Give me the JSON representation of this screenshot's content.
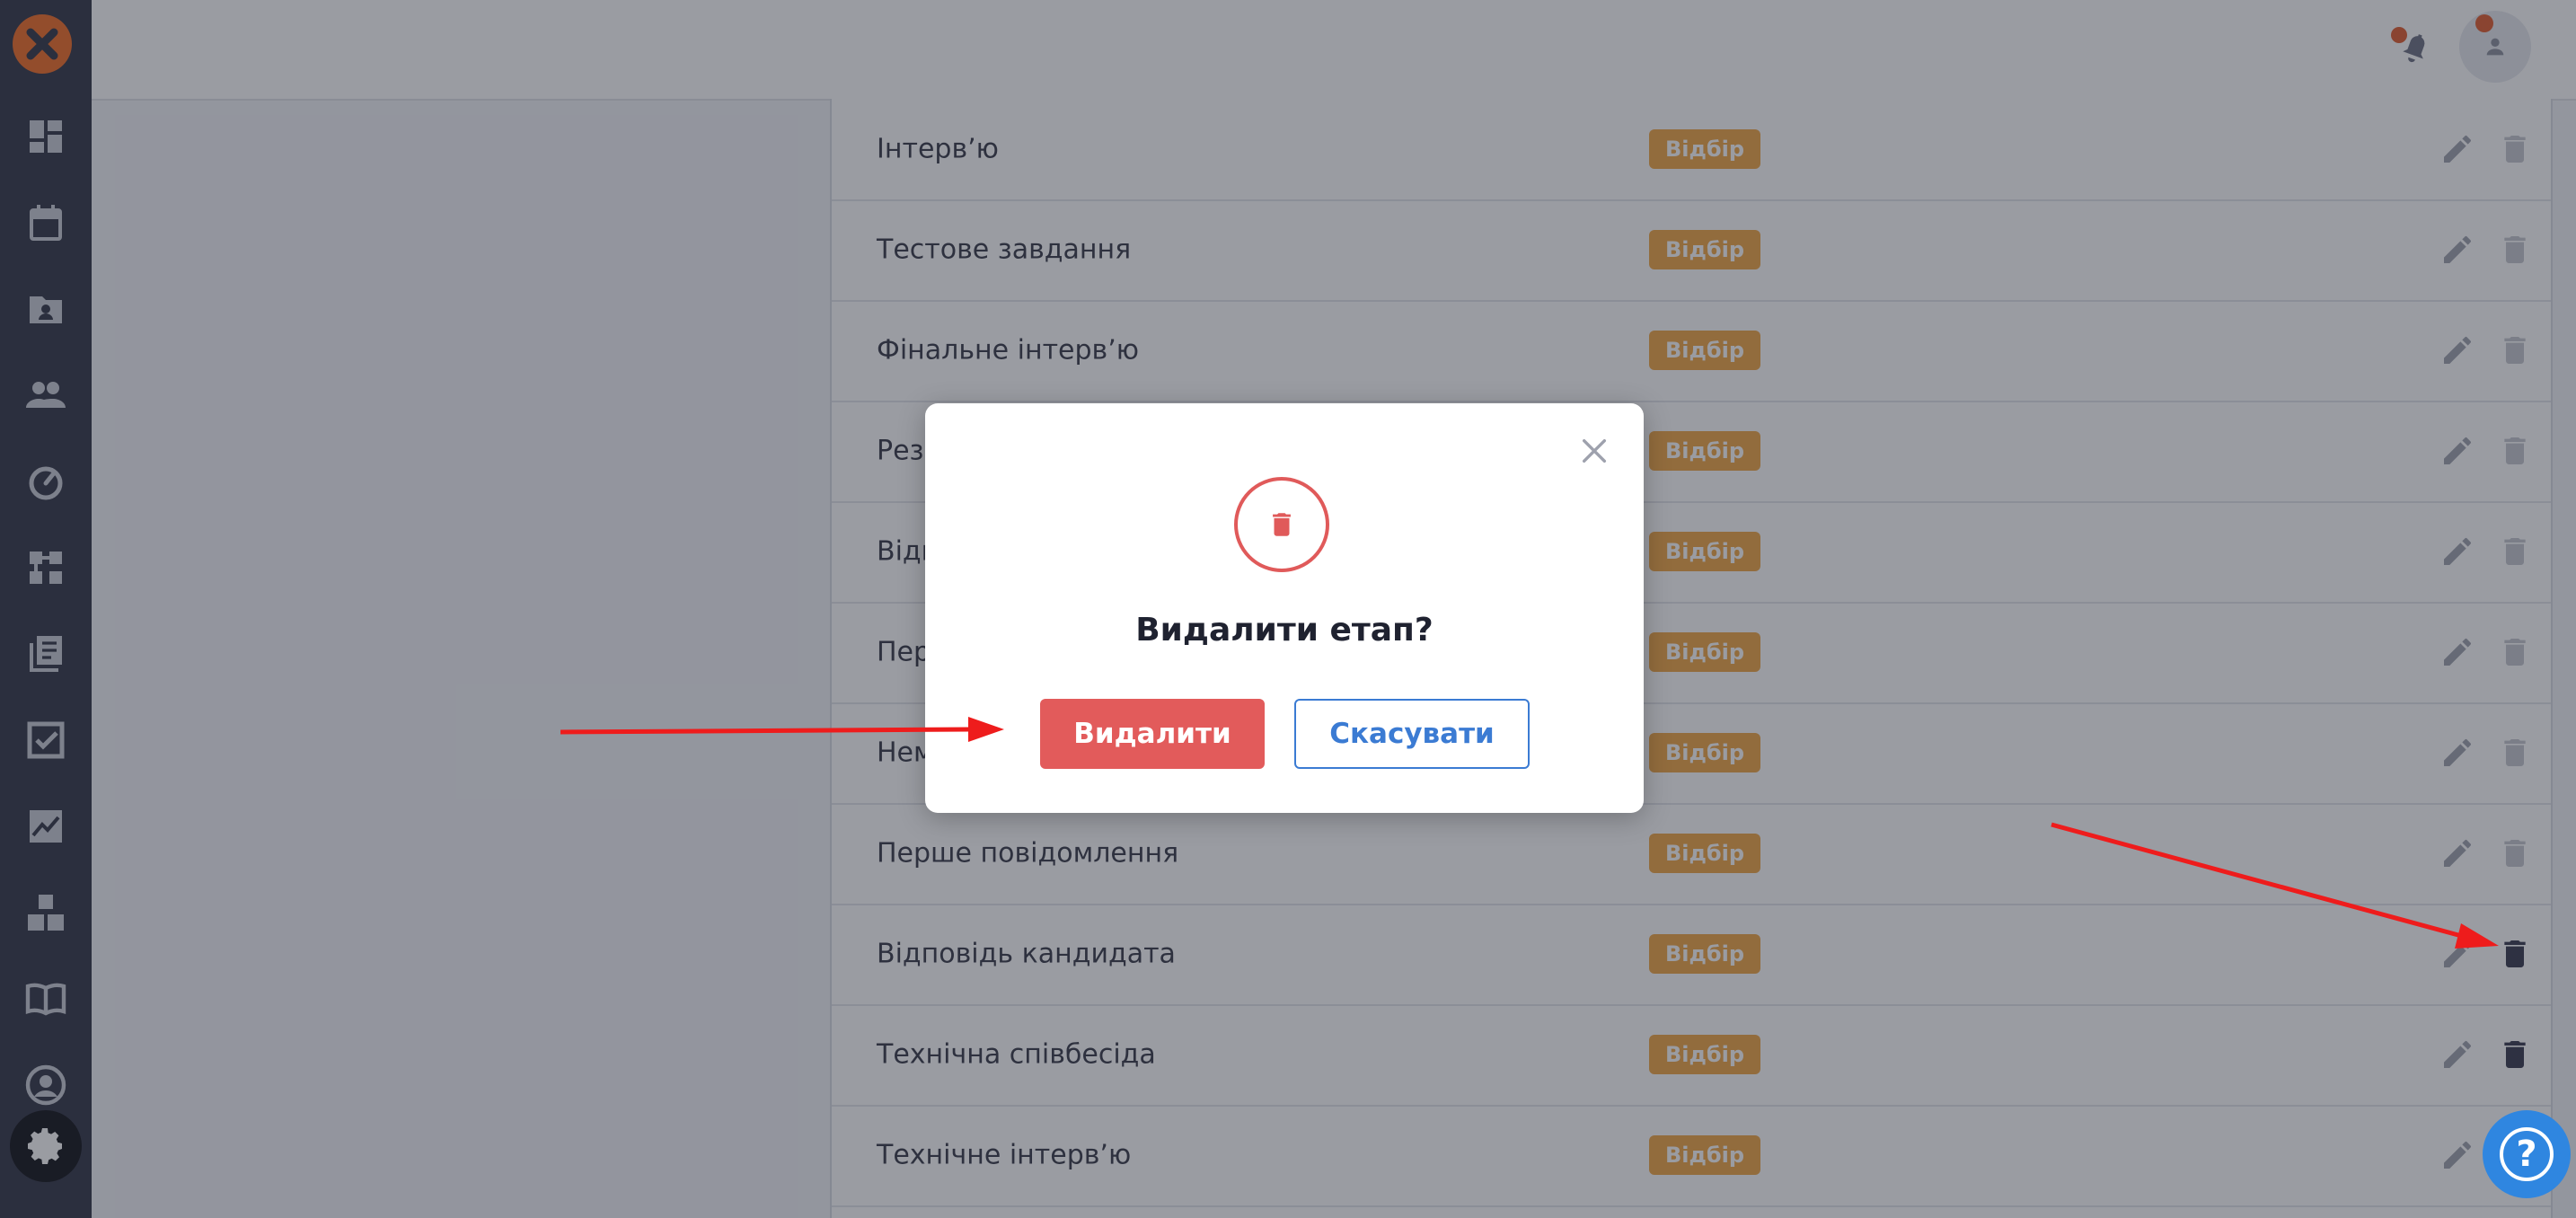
{
  "app": {
    "logo_icon": "app-logo-icon",
    "accent_color": "#f26a21"
  },
  "sidebar": {
    "items": [
      {
        "icon": "dashboard-icon"
      },
      {
        "icon": "calendar-icon"
      },
      {
        "icon": "candidates-folder-icon"
      },
      {
        "icon": "users-icon"
      },
      {
        "icon": "speedometer-icon"
      },
      {
        "icon": "workflow-icon"
      },
      {
        "icon": "library-icon"
      },
      {
        "icon": "checklist-icon"
      },
      {
        "icon": "analytics-icon"
      },
      {
        "icon": "integrations-icon"
      },
      {
        "icon": "knowledge-base-icon"
      },
      {
        "icon": "account-icon"
      },
      {
        "icon": "settings-icon",
        "active": true
      }
    ]
  },
  "header": {
    "bell_icon": "notifications-icon",
    "avatar_icon": "user-avatar-icon"
  },
  "stages": {
    "badge_color": "#f0a440",
    "rows": [
      {
        "label": "Інтерв’ю",
        "badge": "Відбір"
      },
      {
        "label": "Тестове завдання",
        "badge": "Відбір"
      },
      {
        "label": "Фінальне інтерв’ю",
        "badge": "Відбір"
      },
      {
        "label": "Резе",
        "badge": "Відбір"
      },
      {
        "label": "Відп",
        "badge": "Відбір"
      },
      {
        "label": "Перш",
        "badge": "Відбір"
      },
      {
        "label": "Нема",
        "badge": "Відбір"
      },
      {
        "label": "Перше повідомлення",
        "badge": "Відбір"
      },
      {
        "label": "Відповідь кандидата",
        "badge": "Відбір"
      },
      {
        "label": "Технічна співбесіда",
        "badge": "Відбір"
      },
      {
        "label": "Технічне інтерв’ю",
        "badge": "Відбір"
      }
    ]
  },
  "modal": {
    "title": "Видалити етап?",
    "delete_label": "Видалити",
    "cancel_label": "Скасувати",
    "icon": "trash-icon",
    "danger_color": "#e25b5b",
    "cancel_color": "#3b7bd3"
  },
  "help": {
    "label": "?"
  }
}
